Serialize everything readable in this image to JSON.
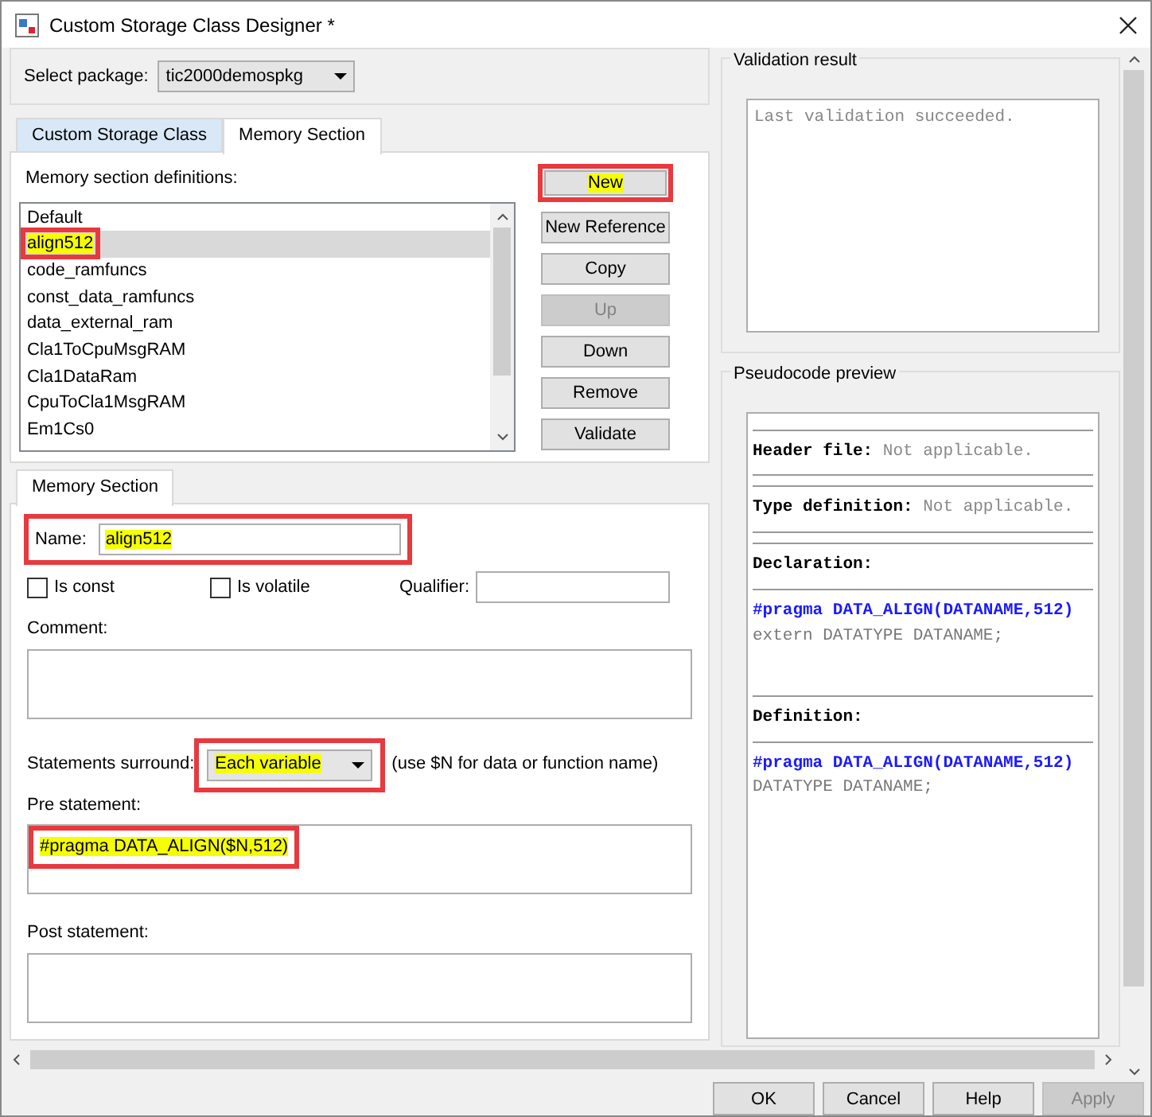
{
  "window": {
    "title": "Custom Storage Class Designer *"
  },
  "package": {
    "label": "Select package:",
    "value": "tic2000demospkg"
  },
  "tabs": [
    {
      "label": "Custom Storage Class",
      "selected": false
    },
    {
      "label": "Memory Section",
      "selected": true
    }
  ],
  "definitions": {
    "label": "Memory section definitions:",
    "items": [
      {
        "text": "Default",
        "selected": false,
        "highlighted": false
      },
      {
        "text": "align512",
        "selected": true,
        "highlighted": true
      },
      {
        "text": "code_ramfuncs",
        "selected": false,
        "highlighted": false
      },
      {
        "text": "const_data_ramfuncs",
        "selected": false,
        "highlighted": false
      },
      {
        "text": "data_external_ram",
        "selected": false,
        "highlighted": false
      },
      {
        "text": "Cla1ToCpuMsgRAM",
        "selected": false,
        "highlighted": false
      },
      {
        "text": "Cla1DataRam",
        "selected": false,
        "highlighted": false
      },
      {
        "text": "CpuToCla1MsgRAM",
        "selected": false,
        "highlighted": false
      },
      {
        "text": "Em1Cs0",
        "selected": false,
        "highlighted": false
      }
    ]
  },
  "buttons": [
    {
      "label": "New",
      "disabled": false,
      "highlighted": true
    },
    {
      "label": "New Reference",
      "disabled": false,
      "highlighted": false
    },
    {
      "label": "Copy",
      "disabled": false,
      "highlighted": false
    },
    {
      "label": "Up",
      "disabled": true,
      "highlighted": false
    },
    {
      "label": "Down",
      "disabled": false,
      "highlighted": false
    },
    {
      "label": "Remove",
      "disabled": false,
      "highlighted": false
    },
    {
      "label": "Validate",
      "disabled": false,
      "highlighted": false
    }
  ],
  "detail_tab": {
    "label": "Memory Section"
  },
  "name": {
    "label": "Name:",
    "value": "align512",
    "highlighted": true
  },
  "checkboxes": [
    {
      "label": "Is const",
      "checked": false
    },
    {
      "label": "Is volatile",
      "checked": false
    }
  ],
  "qualifier": {
    "label": "Qualifier:"
  },
  "comment": {
    "label": "Comment:"
  },
  "statements_surround": {
    "label": "Statements surround:",
    "value": "Each variable",
    "hint": "(use $N for data or function name)",
    "highlighted": true
  },
  "pre_statement": {
    "label": "Pre statement:",
    "value": "#pragma DATA_ALIGN($N,512)",
    "highlighted": true
  },
  "post_statement": {
    "label": "Post statement:"
  },
  "validation": {
    "title": "Validation result",
    "text": "Last validation succeeded."
  },
  "pseudocode": {
    "title": "Pseudocode preview",
    "sections": [
      {
        "heading": "Header file:",
        "text": "Not applicable."
      },
      {
        "heading": "Type definition:",
        "text": "Not applicable."
      },
      {
        "heading": "Declaration:",
        "lines": [
          {
            "kind": "pragma",
            "text": "#pragma DATA_ALIGN(DATANAME,512)"
          },
          {
            "kind": "code",
            "text": "extern DATATYPE DATANAME;"
          }
        ]
      },
      {
        "heading": "Definition:",
        "lines": [
          {
            "kind": "pragma",
            "text": "#pragma DATA_ALIGN(DATANAME,512)"
          },
          {
            "kind": "code",
            "text": "DATATYPE DATANAME;"
          }
        ]
      }
    ]
  },
  "dialog_buttons": [
    {
      "label": "OK",
      "disabled": false
    },
    {
      "label": "Cancel",
      "disabled": false
    },
    {
      "label": "Help",
      "disabled": false
    },
    {
      "label": "Apply",
      "disabled": true
    }
  ]
}
